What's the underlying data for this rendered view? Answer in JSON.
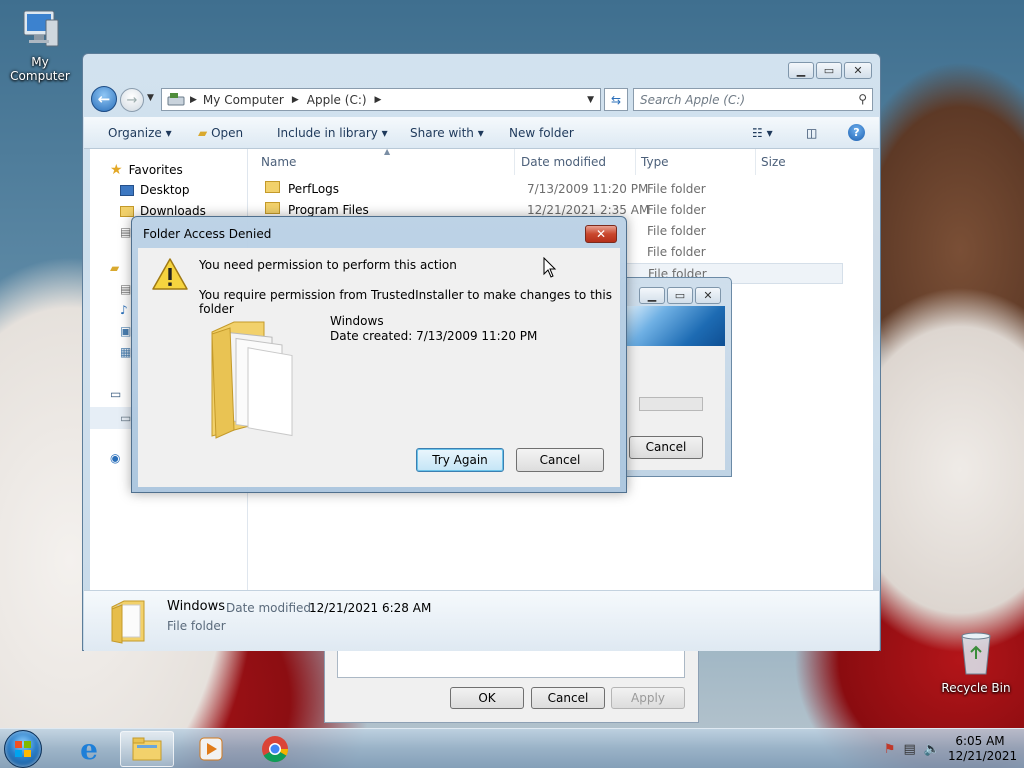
{
  "desktop": {
    "my_computer_label": "My Computer",
    "recycle_bin_label": "Recycle Bin"
  },
  "explorer": {
    "address": {
      "root": "My Computer",
      "drive": "Apple (C:)"
    },
    "search_placeholder": "Search Apple (C:)",
    "toolbar": {
      "organize": "Organize",
      "open": "Open",
      "include_in_library": "Include in library",
      "share_with": "Share with",
      "new_folder": "New folder"
    },
    "nav": {
      "favorites": "Favorites",
      "desktop": "Desktop",
      "downloads": "Downloads"
    },
    "columns": {
      "name": "Name",
      "date_modified": "Date modified",
      "type": "Type",
      "size": "Size"
    },
    "files": [
      {
        "name": "PerfLogs",
        "date": "7/13/2009 11:20 PM",
        "type": "File folder"
      },
      {
        "name": "Program Files",
        "date": "12/21/2021 2:35 AM",
        "type": "File folder"
      },
      {
        "name": "",
        "date": "",
        "type": "File folder"
      },
      {
        "name": "",
        "date": "",
        "type": "File folder"
      },
      {
        "name": "",
        "date": "",
        "type": "File folder"
      }
    ],
    "details": {
      "name": "Windows",
      "date_label": "Date modified:",
      "date_value": "12/21/2021 6:28 AM",
      "type": "File folder"
    }
  },
  "properties": {
    "ok": "OK",
    "cancel": "Cancel",
    "apply": "Apply"
  },
  "progress": {
    "cancel": "Cancel"
  },
  "dialog": {
    "title": "Folder Access Denied",
    "message_main": "You need permission to perform this action",
    "message_detail": "You require permission from TrustedInstaller to make changes to this folder",
    "folder_name": "Windows",
    "folder_date": "Date created: 7/13/2009 11:20 PM",
    "try_again": "Try Again",
    "cancel": "Cancel"
  },
  "taskbar": {
    "time": "6:05 AM",
    "date": "12/21/2021"
  },
  "colors": {
    "accent_blue": "#2a6fba",
    "close_red": "#c9472d",
    "folder_yellow": "#f2d16b"
  }
}
